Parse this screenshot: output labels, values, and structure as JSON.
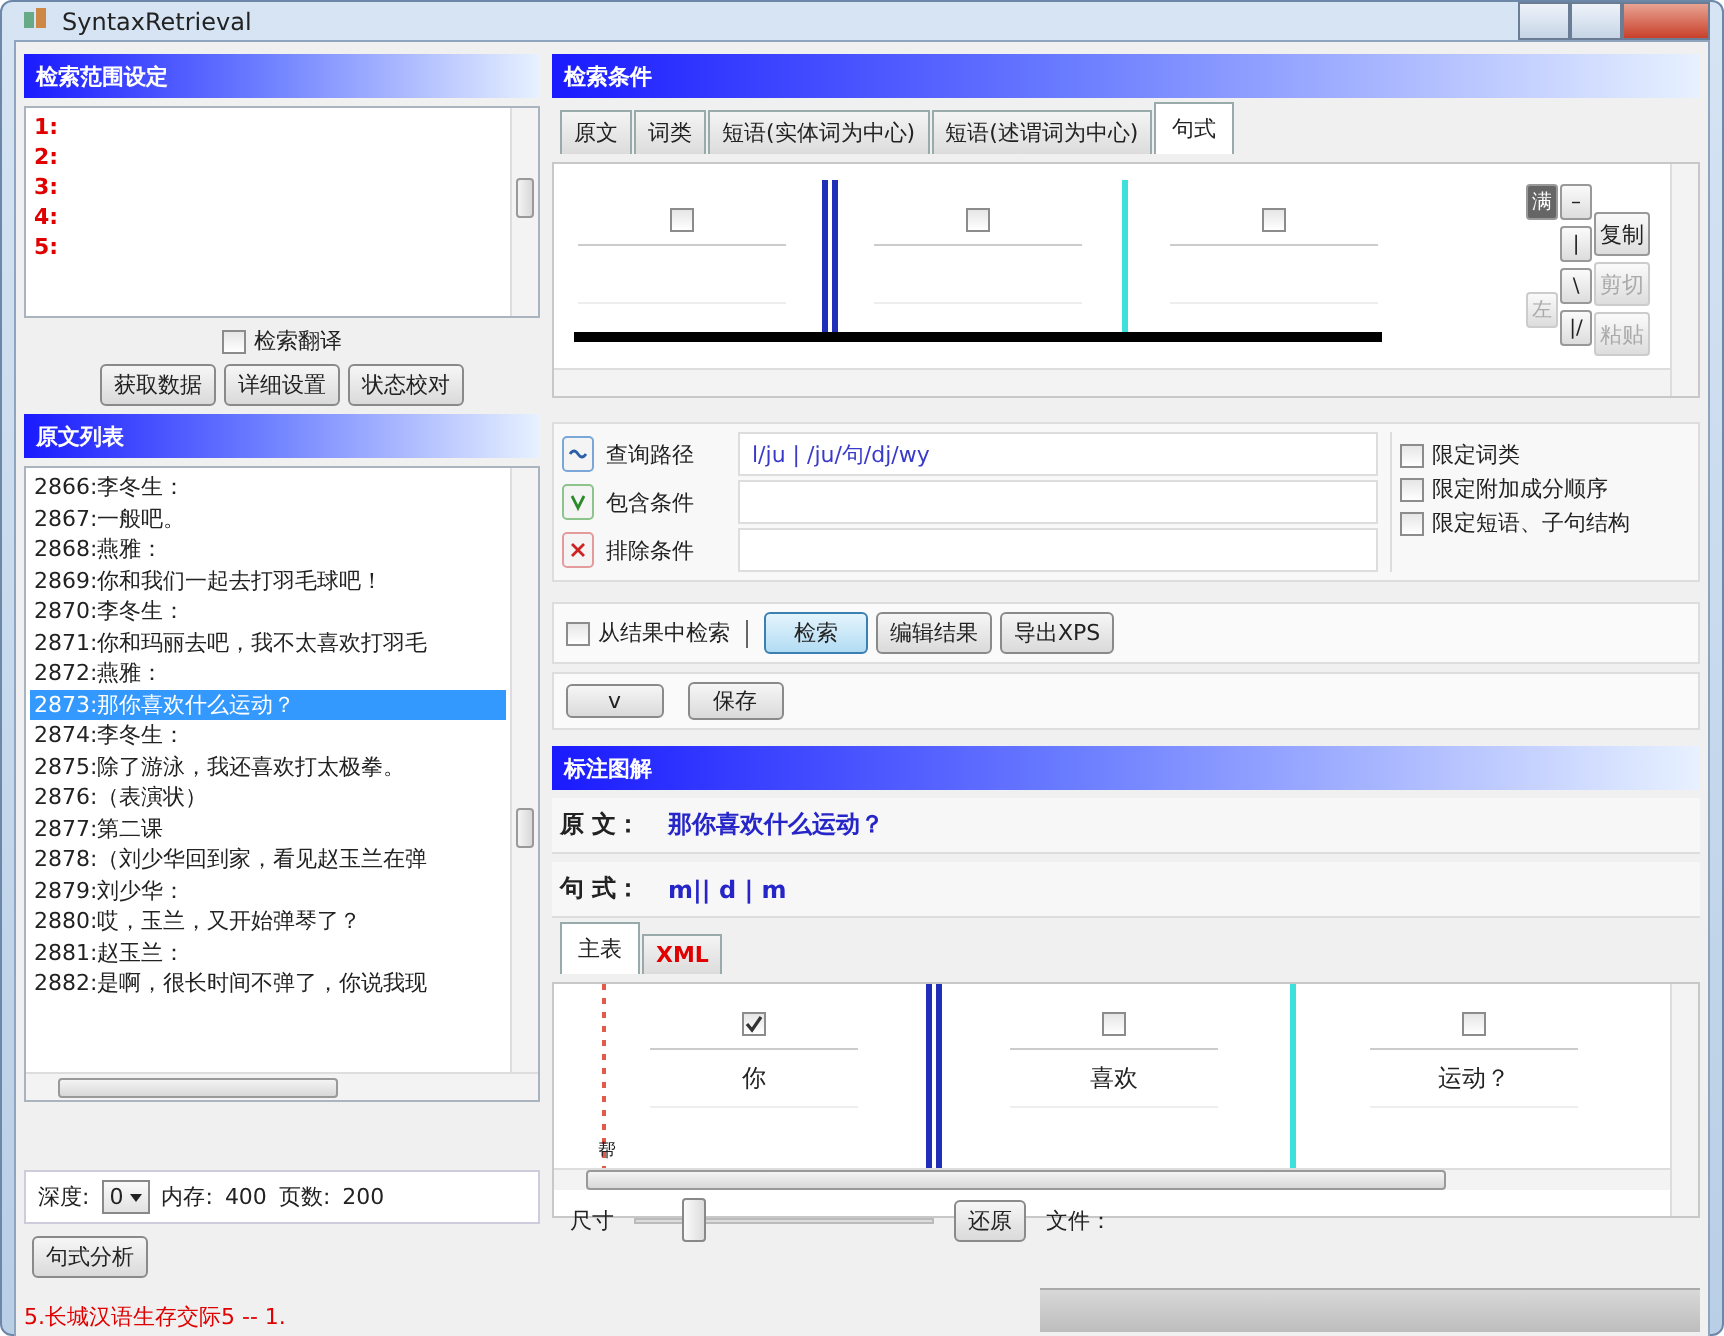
{
  "window": {
    "title": "SyntaxRetrieval"
  },
  "range_panel": {
    "title": "检索范围设定",
    "items": [
      "1:",
      "2:",
      "3:",
      "4:",
      "5:"
    ],
    "translate_checkbox": {
      "label": "检索翻译",
      "checked": false
    },
    "buttons": [
      "获取数据",
      "详细设置",
      "状态校对"
    ]
  },
  "sentence_panel": {
    "title": "原文列表",
    "rows": [
      {
        "text": "2866:李冬生：",
        "selected": false
      },
      {
        "text": "2867:一般吧。",
        "selected": false
      },
      {
        "text": "2868:燕雅：",
        "selected": false
      },
      {
        "text": "2869:你和我们一起去打羽毛球吧！",
        "selected": false
      },
      {
        "text": "2870:李冬生：",
        "selected": false
      },
      {
        "text": "2871:你和玛丽去吧，我不太喜欢打羽毛",
        "selected": false
      },
      {
        "text": "2872:燕雅：",
        "selected": false
      },
      {
        "text": "2873:那你喜欢什么运动？",
        "selected": true
      },
      {
        "text": "2874:李冬生：",
        "selected": false
      },
      {
        "text": "2875:除了游泳，我还喜欢打太极拳。",
        "selected": false
      },
      {
        "text": "2876:（表演状）",
        "selected": false
      },
      {
        "text": "2877:第二课",
        "selected": false
      },
      {
        "text": "2878:（刘少华回到家，看见赵玉兰在弹",
        "selected": false
      },
      {
        "text": "2879:刘少华：",
        "selected": false
      },
      {
        "text": "2880:哎，玉兰，又开始弹琴了？",
        "selected": false
      },
      {
        "text": "2881:赵玉兰：",
        "selected": false
      },
      {
        "text": "2882:是啊，很长时间不弹了，你说我现",
        "selected": false
      }
    ],
    "depth": {
      "label": "深度:",
      "value": "0"
    },
    "memory": {
      "label": "内存:",
      "value": "400"
    },
    "pages": {
      "label": "页数:",
      "value": "200"
    },
    "analyze_button": "句式分析"
  },
  "status_text": "5.长城汉语生存交际5 -- 1.",
  "search_panel": {
    "title": "检索条件",
    "tabs": [
      {
        "label": "原文",
        "selected": false
      },
      {
        "label": "词类",
        "selected": false
      },
      {
        "label": "短语(实体词为中心)",
        "selected": false
      },
      {
        "label": "短语(述谓词为中心)",
        "selected": false
      },
      {
        "label": "句式",
        "selected": true
      }
    ],
    "cells": [
      {
        "kind": "slot",
        "checked": false
      },
      {
        "kind": "double_divider"
      },
      {
        "kind": "slot",
        "checked": false
      },
      {
        "kind": "single_divider"
      },
      {
        "kind": "slot",
        "checked": false
      }
    ],
    "tool_columns": [
      [
        {
          "label": "满",
          "disabled": false
        },
        {
          "label": "左",
          "disabled": true
        }
      ],
      [
        {
          "label": "–",
          "disabled": false
        },
        {
          "label": "|",
          "disabled": false
        },
        {
          "label": "\\",
          "disabled": false
        },
        {
          "label": "|/",
          "disabled": false
        }
      ],
      [
        {
          "label": "复制",
          "disabled": false
        },
        {
          "label": "剪切",
          "disabled": true
        },
        {
          "label": "粘贴",
          "disabled": true
        }
      ]
    ],
    "conditions": [
      {
        "kind": "path",
        "label": "查询路径",
        "value": "l/ju | /ju/句/dj/wy"
      },
      {
        "kind": "include",
        "label": "包含条件"
      },
      {
        "kind": "exclude",
        "label": "排除条件"
      }
    ],
    "limits": [
      {
        "label": "限定词类",
        "checked": false
      },
      {
        "label": "限定附加成分顺序",
        "checked": false
      },
      {
        "label": "限定短语、子句结构",
        "checked": false
      }
    ],
    "from_results": {
      "label": "从结果中检索",
      "checked": false
    },
    "action_buttons": [
      {
        "label": "检索",
        "selected": true
      },
      {
        "label": "编辑结果",
        "selected": false
      },
      {
        "label": "导出XPS",
        "selected": false
      }
    ],
    "toggle_button": "v",
    "save_button": "保存"
  },
  "annotation_panel": {
    "title": "标注图解",
    "original": {
      "label": "原 文：",
      "value": "那你喜欢什么运动？"
    },
    "pattern": {
      "label": "句 式：",
      "value": "m|| d | m"
    },
    "tabs": [
      {
        "label": "主表",
        "selected": true
      },
      {
        "label": "XML",
        "selected": false
      }
    ],
    "marker_label": "帮",
    "cells": [
      {
        "kind": "word",
        "text": "你",
        "checked": true
      },
      {
        "kind": "double_divider"
      },
      {
        "kind": "word",
        "text": "喜欢",
        "checked": false
      },
      {
        "kind": "single_divider"
      },
      {
        "kind": "word",
        "text": "运动？",
        "checked": false
      }
    ],
    "size_label": "尺寸",
    "size": {
      "level": 0.2
    },
    "reset_button": "还原",
    "file_label": "文件："
  }
}
